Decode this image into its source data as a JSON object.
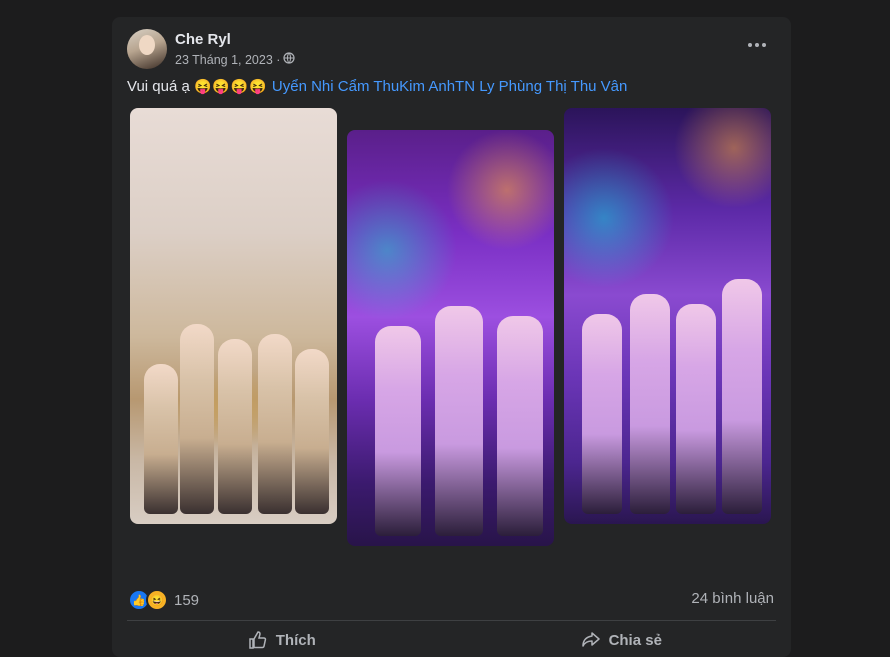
{
  "post": {
    "author": "Che Ryl",
    "date": "23 Tháng 1, 2023 ·",
    "caption_text": "Vui quá ạ",
    "caption_emojis": "😝😝😝😝",
    "tags": "Uyển Nhi Cẩm ThuKim AnhTN Ly Phùng Thị Thu Vân",
    "reaction_count": "159",
    "comment_count": "24 bình luận"
  },
  "actions": {
    "like_label": "Thích",
    "share_label": "Chia sẻ"
  },
  "icons": {
    "privacy": "globe-icon",
    "more": "more-options-icon",
    "like_reaction": "like-reaction-icon",
    "haha_reaction": "haha-reaction-icon"
  },
  "colors": {
    "background": "#1c1c1d",
    "card": "#242526",
    "link": "#4599ff",
    "muted": "#b0b3b8"
  }
}
